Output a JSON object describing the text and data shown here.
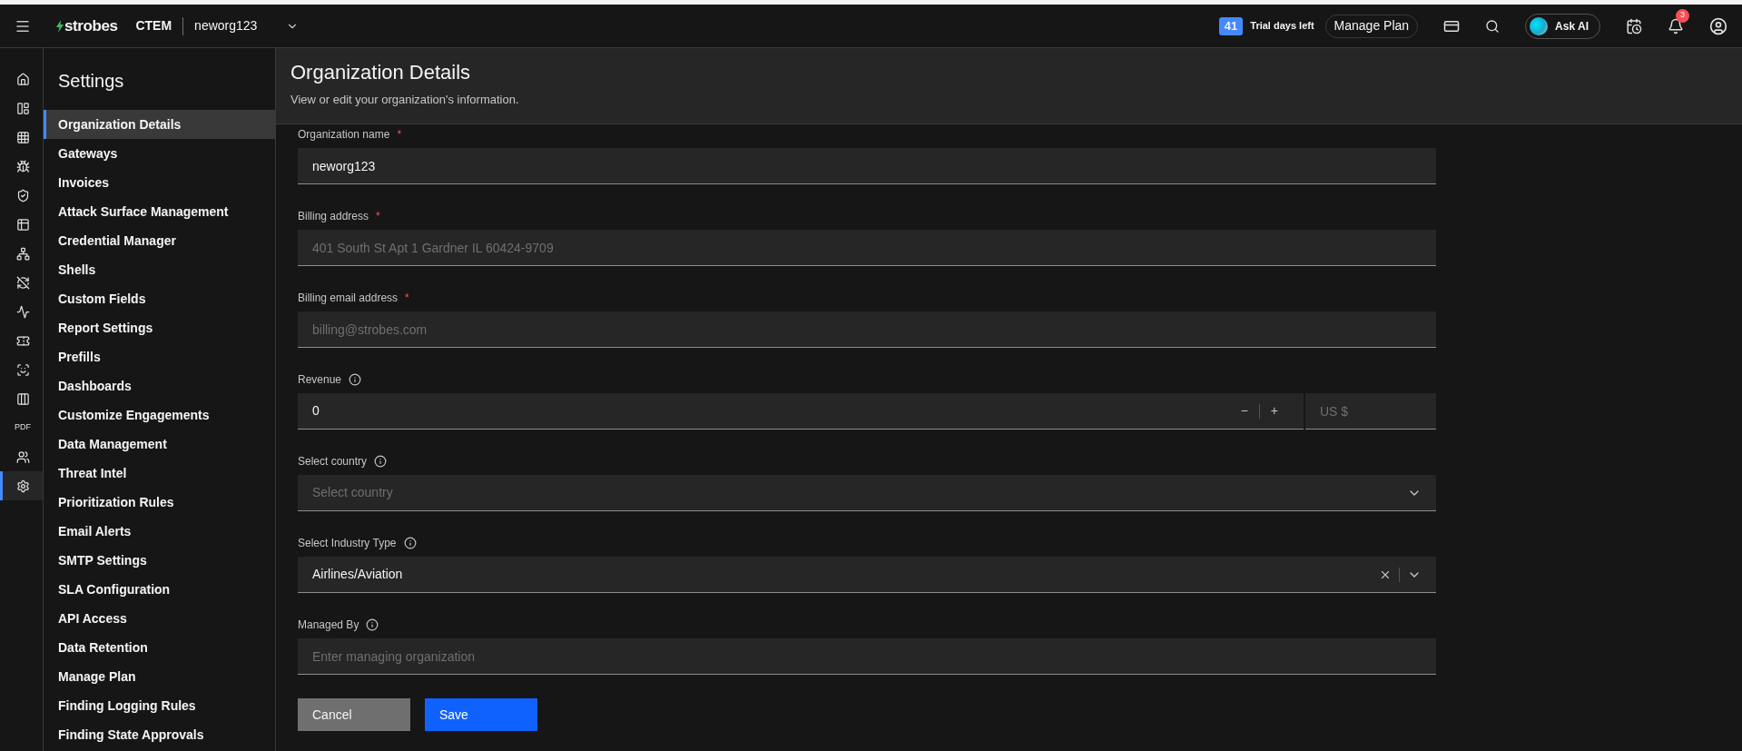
{
  "topbar": {
    "brand": "strobes",
    "product": "CTEM",
    "org": "neworg123",
    "trial_days": "41",
    "trial_label": "Trial days left",
    "manage_plan": "Manage Plan",
    "ask_ai": "Ask AI",
    "notifications": "3"
  },
  "rail": [
    {
      "selected": false
    },
    {
      "selected": false
    },
    {
      "selected": false
    },
    {
      "selected": false
    },
    {
      "selected": false
    },
    {
      "selected": false
    },
    {
      "selected": false
    },
    {
      "selected": false
    },
    {
      "selected": false
    },
    {
      "selected": false
    },
    {
      "selected": false
    },
    {
      "selected": false
    },
    {
      "label": "PDF",
      "selected": false
    },
    {
      "selected": false
    },
    {
      "selected": true
    }
  ],
  "sidebar": {
    "title": "Settings",
    "items": [
      {
        "label": "Organization Details",
        "selected": true
      },
      {
        "label": "Gateways",
        "selected": false
      },
      {
        "label": "Invoices",
        "selected": false
      },
      {
        "label": "Attack Surface Management",
        "selected": false
      },
      {
        "label": "Credential Manager",
        "selected": false
      },
      {
        "label": "Shells",
        "selected": false
      },
      {
        "label": "Custom Fields",
        "selected": false
      },
      {
        "label": "Report Settings",
        "selected": false
      },
      {
        "label": "Prefills",
        "selected": false
      },
      {
        "label": "Dashboards",
        "selected": false
      },
      {
        "label": "Customize Engagements",
        "selected": false
      },
      {
        "label": "Data Management",
        "selected": false
      },
      {
        "label": "Threat Intel",
        "selected": false
      },
      {
        "label": "Prioritization Rules",
        "selected": false
      },
      {
        "label": "Email Alerts",
        "selected": false
      },
      {
        "label": "SMTP Settings",
        "selected": false
      },
      {
        "label": "SLA Configuration",
        "selected": false
      },
      {
        "label": "API Access",
        "selected": false
      },
      {
        "label": "Data Retention",
        "selected": false
      },
      {
        "label": "Manage Plan",
        "selected": false
      },
      {
        "label": "Finding Logging Rules",
        "selected": false
      },
      {
        "label": "Finding State Approvals",
        "selected": false
      }
    ]
  },
  "page": {
    "title": "Organization Details",
    "subtitle": "View or edit your organization's information."
  },
  "fields": [
    {
      "kind": "text",
      "label": "Organization name",
      "required_mark": "*",
      "info": false,
      "value": "neworg123"
    },
    {
      "kind": "text",
      "label": "Billing address",
      "required_mark": "*",
      "info": false,
      "placeholder": "401 South St Apt 1 Gardner IL 60424-9709"
    },
    {
      "kind": "text",
      "label": "Billing email address",
      "required_mark": "*",
      "info": false,
      "placeholder": "billing@strobes.com"
    },
    {
      "kind": "number",
      "label": "Revenue",
      "info": true,
      "value": "0",
      "minus": "−",
      "plus": "+",
      "currency_placeholder": "US $"
    },
    {
      "kind": "select",
      "label": "Select country",
      "info": true,
      "placeholder": "Select country",
      "clearable": false
    },
    {
      "kind": "select",
      "label": "Select Industry Type",
      "info": true,
      "value": "Airlines/Aviation",
      "clearable": true
    },
    {
      "kind": "text",
      "label": "Managed By",
      "info": true,
      "placeholder": "Enter managing organization"
    }
  ],
  "buttons": [
    {
      "kind": "secondary",
      "label": "Cancel"
    },
    {
      "kind": "primary",
      "label": "Save"
    }
  ]
}
